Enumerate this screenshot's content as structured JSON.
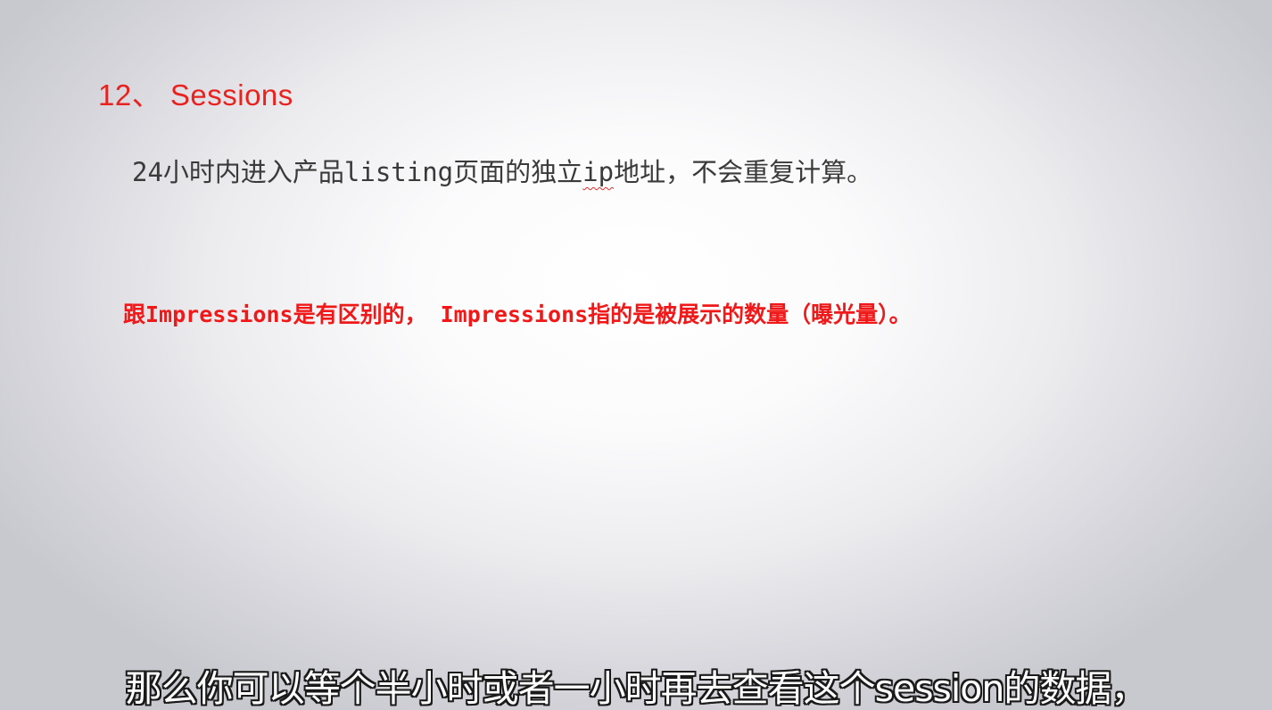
{
  "slide": {
    "title": "12、 Sessions",
    "definition_before": "24小时内进入产品listing页面的独立",
    "definition_marked": "ip",
    "definition_after": "地址，不会重复计算。",
    "note": "跟Impressions是有区别的， Impressions指的是被展示的数量（曝光量）。"
  },
  "subtitle": {
    "text": "那么你可以等个半小时或者一小时再去查看这个session的数据，"
  },
  "colors": {
    "title": "#e8231f",
    "definition": "#3a3a3a",
    "note": "#f01818",
    "subtitle_fill": "#ffffff",
    "subtitle_outline": "#1a1a1a"
  }
}
